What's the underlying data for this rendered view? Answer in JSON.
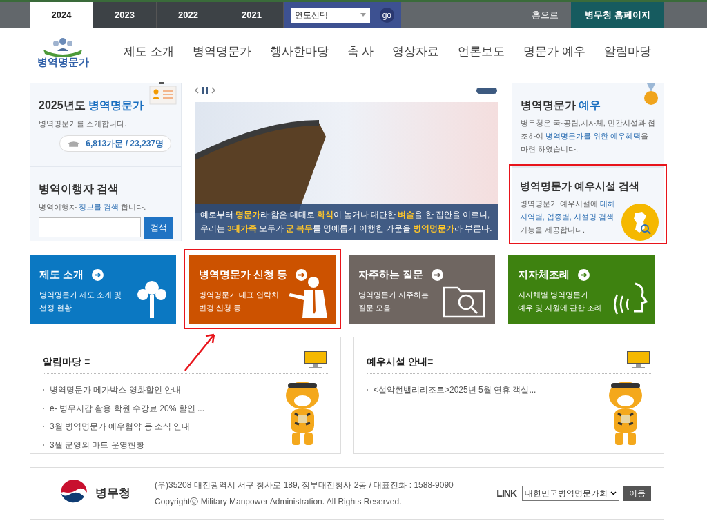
{
  "top_bar": {
    "year_tabs": [
      {
        "label": "2024",
        "selected": true
      },
      {
        "label": "2023",
        "selected": false
      },
      {
        "label": "2022",
        "selected": false
      },
      {
        "label": "2021",
        "selected": false
      }
    ],
    "year_select": {
      "value": "연도선택"
    },
    "go_button": "go",
    "home_link": "홈으로",
    "agency_link": "병무청 홈페이지"
  },
  "header": {
    "logo_text": "병역명문가",
    "menu": [
      "제도 소개",
      "병역명문가",
      "행사한마당",
      "축 사",
      "영상자료",
      "언론보도",
      "명문가 예우",
      "알림마당"
    ]
  },
  "intro_card": {
    "title_parts": [
      {
        "text": "2025년도 ",
        "highlight": false
      },
      {
        "text": "병역명문가",
        "highlight": true
      }
    ],
    "description": "병역명문가를 소개합니다.",
    "count": "6,813가문 / 23,237명"
  },
  "search_card": {
    "title": "병역이행자 검색",
    "description_parts": [
      {
        "text": "병역이행자 ",
        "highlight": false
      },
      {
        "text": "정보를 검색",
        "highlight": true
      },
      {
        "text": " 합니다.",
        "highlight": false
      }
    ],
    "button": "검색"
  },
  "banner": {
    "caption": [
      "예로부터 **명문가**라 함은 대대로 **화식**이 높거나 대단한 **벼슬**을 한 집안을 이르니,",
      "우리는 **3대가족** 모두가 **군 복무**를 명예롭게 이행한 가문을 **병역명문가**라 부른다."
    ]
  },
  "benefit_card": {
    "title_parts": [
      {
        "text": "병역명문가 ",
        "highlight": false
      },
      {
        "text": "예우",
        "highlight": true
      }
    ],
    "description_parts": [
      {
        "text": "병무청은 국·공립,지자체, 민간시설과 협조하여 ",
        "highlight": false
      },
      {
        "text": "병역명문가를 위한 예우혜택",
        "highlight": true
      },
      {
        "text": "을 마련 하였습니다.",
        "highlight": false
      }
    ]
  },
  "facility_card": {
    "highlighted": true,
    "title": "병역명문가 예우시설 검색",
    "description_parts": [
      {
        "text": "병역명문가 예우시설에 ",
        "highlight": false
      },
      {
        "text": "대해 지역별, 업종별, 시설명 검색",
        "highlight": true
      },
      {
        "text": "기능을 제공합니다.",
        "highlight": false
      }
    ]
  },
  "tiles": [
    {
      "kind": "tree",
      "title": "제도 소개",
      "lines": [
        "병역명문가 제도 소개 및",
        "선정 현황"
      ],
      "color": "#0b78c2",
      "highlighted": false
    },
    {
      "kind": "person",
      "title": "병역명문가 신청 등",
      "lines": [
        "병역명문가 대표 연락처",
        "변경 신청 등"
      ],
      "color": "#cc5200",
      "highlighted": true
    },
    {
      "kind": "folder",
      "title": "자주하는 질문",
      "lines": [
        "병역명문가 자주하는",
        "질문 모음"
      ],
      "color": "#6f6661",
      "highlighted": false
    },
    {
      "kind": "speech",
      "title": "지자체조례",
      "lines": [
        "지자체별 병역명문가",
        "예우 및 지원에 관한 조례"
      ],
      "color": "#3e8210",
      "highlighted": false
    }
  ],
  "news_boxes": [
    {
      "title": "알림마당 ≡",
      "items": [
        "병역명문가 메가박스 영화할인 안내",
        "e- 병무지갑 활용 학원 수강료 20% 할인 ...",
        "3월 병역명문가 예우협약 등 소식 안내",
        "3월 군영외 마트 운영현황"
      ]
    },
    {
      "title": "예우시설 안내≡",
      "items": [
        "<설악썬밸리리조트>2025년 5월 연휴 객실..."
      ]
    }
  ],
  "footer": {
    "logo_text": "병무청",
    "address": "(우)35208 대전광역시 서구 청사로 189, 정부대전청사 2동 / 대표전화 : 1588-9090",
    "copyright": "Copyrightⓒ Military Manpower Administration. All Rights Reserved.",
    "link_label": "LINK",
    "link_select": "대한민국병역명문가회",
    "link_button": "이동"
  }
}
